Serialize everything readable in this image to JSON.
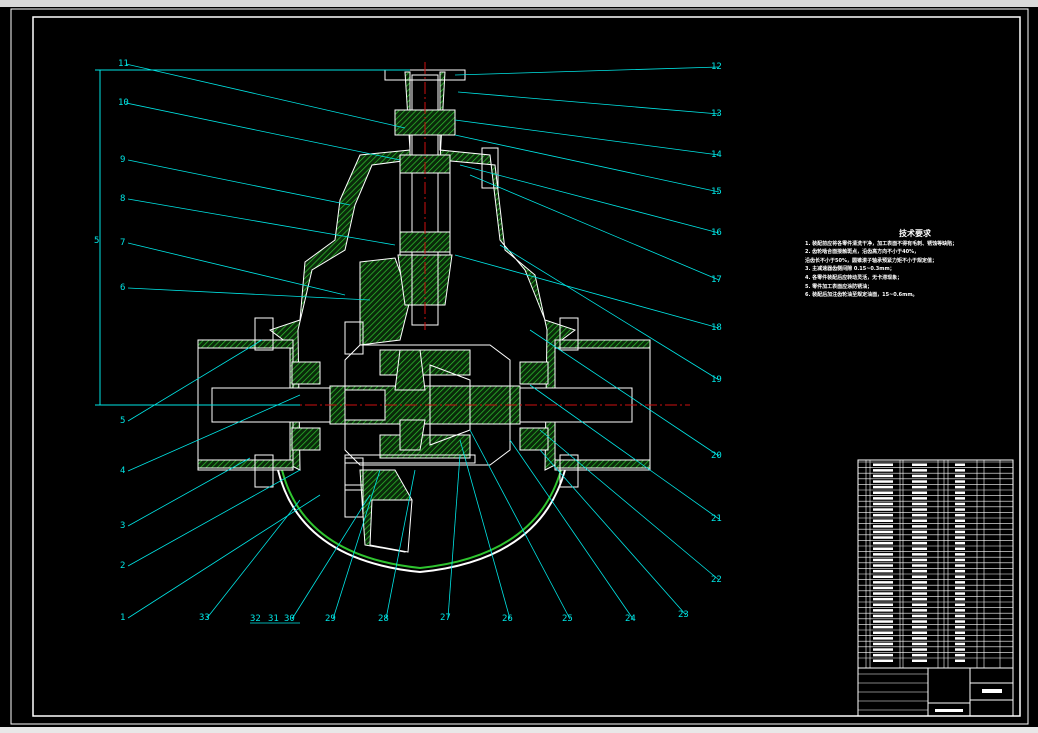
{
  "drawing": {
    "colors": {
      "background": "#000000",
      "outline": "#ffffff",
      "leader": "#00e5e5",
      "hatch": "#2fc42f",
      "centerline": "#cc1010"
    },
    "part_labels_left": [
      "11",
      "10",
      "9",
      "8",
      "7",
      "6",
      "5",
      "4",
      "3",
      "2",
      "1"
    ],
    "part_labels_right": [
      "12",
      "13",
      "14",
      "15",
      "16",
      "17",
      "18",
      "19",
      "20",
      "21",
      "22"
    ],
    "part_labels_bottom": [
      "33",
      "32",
      "31",
      "30",
      "29",
      "28",
      "27",
      "26",
      "25",
      "24",
      "23"
    ],
    "dimension_label": "5"
  },
  "tech_requirements": {
    "title": "技术要求",
    "lines": [
      "1. 装配前应将各零件清洗干净，加工表面不得有毛刺、锈蚀等缺陷；",
      "2. 齿轮啮合面接触斑点，沿齿高方向不小于40%，",
      "沿齿长不小于50%，圆锥滚子轴承预紧力矩不小于规定值；",
      "3. 主减速器齿侧间隙 0.15~0.3mm；",
      "4. 各零件装配后应转动灵活，无卡滞现象；",
      "5. 零件加工表面应涂防锈油；",
      "6. 装配后加注齿轮油至规定油面，15~0.6mm。"
    ]
  },
  "title_block": {
    "rows": 36
  }
}
